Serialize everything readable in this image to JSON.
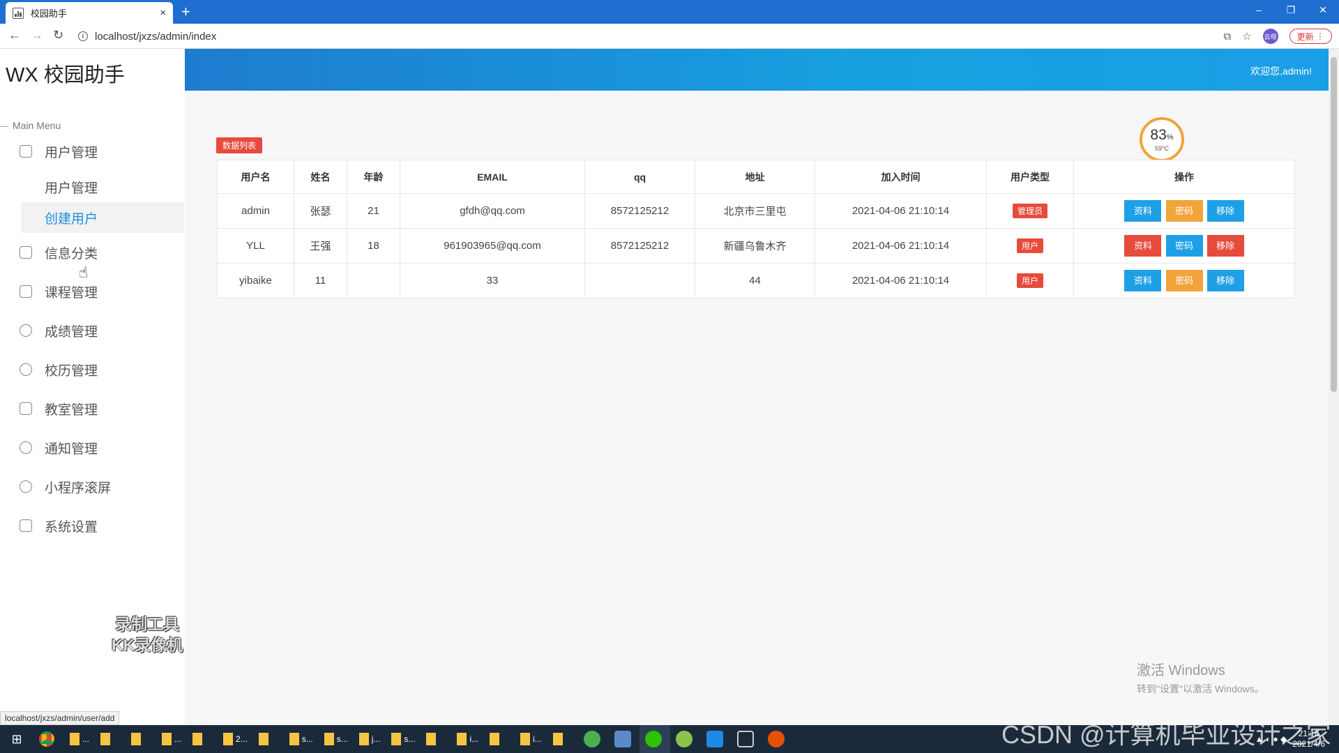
{
  "browser": {
    "tab_title": "校园助手",
    "tab_close": "×",
    "new_tab": "+",
    "url": "localhost/jxzs/admin/index",
    "update_label": "更新",
    "profile_label": "云母",
    "win_minimize": "–",
    "win_restore": "❐",
    "win_close": "✕"
  },
  "sidebar": {
    "logo": "WX 校园助手",
    "menu_caption": "Main Menu",
    "items": [
      {
        "label": "用户管理"
      },
      {
        "label": "信息分类"
      },
      {
        "label": "课程管理"
      },
      {
        "label": "成绩管理"
      },
      {
        "label": "校历管理"
      },
      {
        "label": "教室管理"
      },
      {
        "label": "通知管理"
      },
      {
        "label": "小程序滚屏"
      },
      {
        "label": "系统设置"
      }
    ],
    "sub_items": [
      {
        "label": "用户管理"
      },
      {
        "label": "创建用户"
      }
    ]
  },
  "header": {
    "welcome": "欢迎您,admin!"
  },
  "gauge": {
    "value": "83",
    "unit": "%",
    "temp": "59°C"
  },
  "main": {
    "section_label": "数据列表",
    "columns": [
      "用户名",
      "姓名",
      "年龄",
      "EMAIL",
      "qq",
      "地址",
      "加入时间",
      "用户类型",
      "操作"
    ],
    "rows": [
      {
        "username": "admin",
        "name": "张瑟",
        "age": "21",
        "email": "gfdh@qq.com",
        "qq": "8572125212",
        "address": "北京市三里屯",
        "joined": "2021-04-06 21:10:14",
        "type": "管理员"
      },
      {
        "username": "YLL",
        "name": "王强",
        "age": "18",
        "email": "961903965@qq.com",
        "qq": "8572125212",
        "address": "新疆乌鲁木齐",
        "joined": "2021-04-06 21:10:14",
        "type": "用户"
      },
      {
        "username": "yibaike",
        "name": "11",
        "age": "",
        "email": "33",
        "qq": "",
        "address": "44",
        "joined": "2021-04-06 21:10:14",
        "type": "用户"
      }
    ],
    "actions": {
      "profile": "资料",
      "password": "密码",
      "remove": "移除"
    }
  },
  "status_bar_url": "localhost/jxzs/admin/user/add",
  "watermarks": {
    "recorder_line1": "录制工具",
    "recorder_line2": "KK录像机",
    "activate_line1": "激活 Windows",
    "activate_line2": "转到\"设置\"以激活 Windows。",
    "csdn": "CSDN @计算机毕业设计之家"
  },
  "taskbar": {
    "items": [
      "...",
      "",
      "",
      "...",
      "",
      "2...",
      "",
      "s...",
      "s...",
      "j...",
      "s...",
      "",
      "i...",
      "",
      "i...",
      "",
      ""
    ],
    "clock_time": "21:16",
    "clock_date": "2021/4/6"
  },
  "colors": {
    "header_blue": "#1e7ccf",
    "accent_red": "#e64b3c",
    "accent_orange": "#f2a33a",
    "accent_blue": "#1ea0e6"
  }
}
